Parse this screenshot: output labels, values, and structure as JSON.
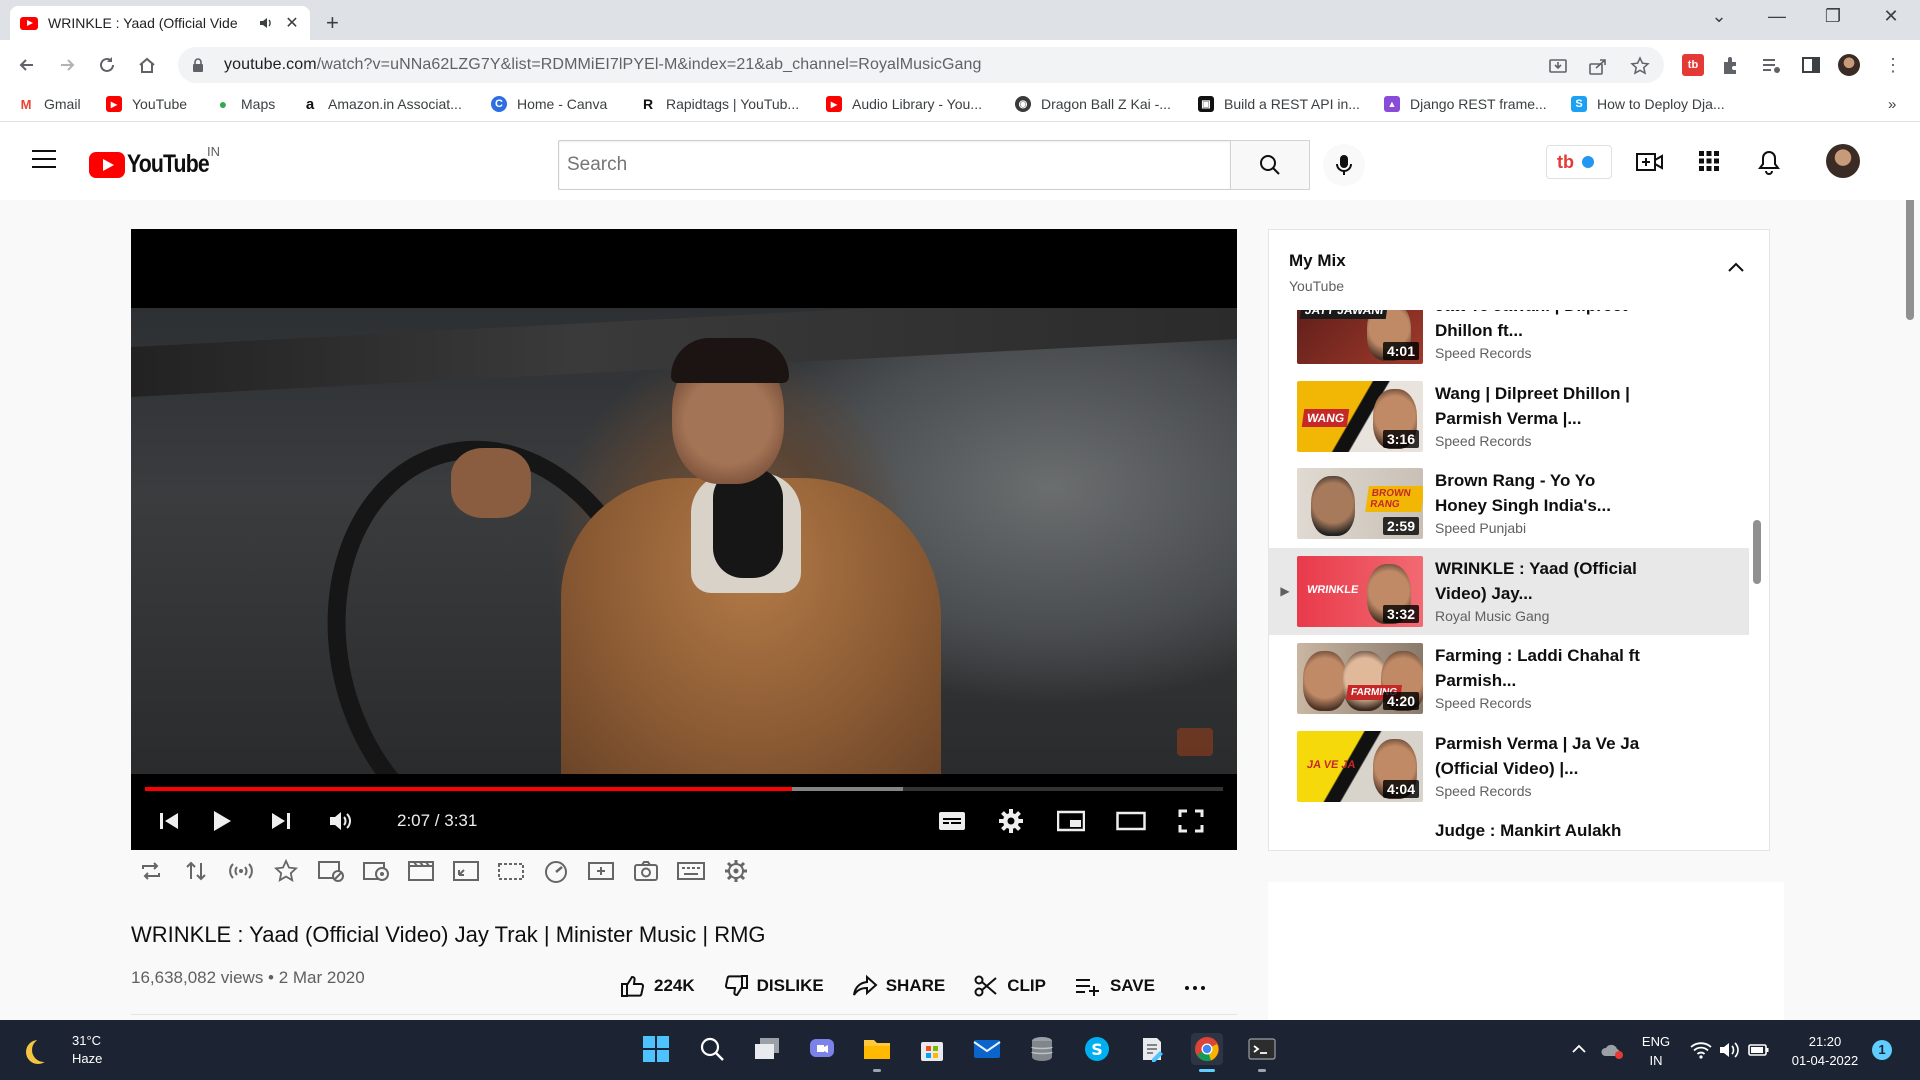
{
  "browser": {
    "tab_title": "WRINKLE : Yaad (Official Vide",
    "address": {
      "host": "youtube.com",
      "path": "/watch?v=uNNa62LZG7Y&list=RDMMiEI7lPYEl-M&index=21&ab_channel=RoyalMusicGang"
    },
    "bookmarks": [
      {
        "label": "Gmail",
        "icon": "gmail-icon",
        "color": "#ea4335",
        "glyph": "M"
      },
      {
        "label": "YouTube",
        "icon": "youtube-icon",
        "color": "#ff0000",
        "glyph": "▶"
      },
      {
        "label": "Maps",
        "icon": "maps-icon",
        "color": "#34a853",
        "glyph": "●"
      },
      {
        "label": "Amazon.in Associat...",
        "icon": "amazon-icon",
        "color": "#ffffff",
        "glyph": "a"
      },
      {
        "label": "Home - Canva",
        "icon": "canva-icon",
        "color": "#2d6ee0",
        "glyph": "C"
      },
      {
        "label": "Rapidtags | YouTub...",
        "icon": "rapidtags-icon",
        "color": "#ffffff",
        "glyph": "R"
      },
      {
        "label": "Audio Library - You...",
        "icon": "youtube-icon",
        "color": "#ff0000",
        "glyph": "▶"
      },
      {
        "label": "Dragon Ball Z Kai -...",
        "icon": "dragonball-icon",
        "color": "#3a3a3a",
        "glyph": "◉"
      },
      {
        "label": "Build a REST API in...",
        "icon": "dev-icon",
        "color": "#111111",
        "glyph": "▣"
      },
      {
        "label": "Django REST frame...",
        "icon": "django-icon",
        "color": "#8a4bd8",
        "glyph": "▲"
      },
      {
        "label": "How to Deploy Dja...",
        "icon": "s-icon",
        "color": "#1ca0f2",
        "glyph": "S"
      }
    ]
  },
  "youtube": {
    "logo_text": "YouTube",
    "country_code": "IN",
    "search_placeholder": "Search",
    "player": {
      "current_time": "2:07",
      "duration": "3:31",
      "time_display": "2:07 / 3:31",
      "progress_fraction": 0.6,
      "buffered_fraction": 0.703
    },
    "video": {
      "title": "WRINKLE : Yaad (Official Video) Jay Trak | Minister Music | RMG",
      "views": "16,638,082 views",
      "date": "2 Mar 2020",
      "view_line": "16,638,082 views • 2 Mar 2020",
      "likes": "224K",
      "dislike_label": "DISLIKE",
      "share_label": "SHARE",
      "clip_label": "CLIP",
      "save_label": "SAVE"
    },
    "playlist": {
      "title": "My Mix",
      "subtitle": "YouTube",
      "items": [
        {
          "title": "Jatt Te Jawani | Dilpreet Dhillon ft...",
          "channel": "Speed Records",
          "duration": "4:01",
          "badge": "JATT JAWANI",
          "color": "#8c2a22",
          "active": false
        },
        {
          "title": "Wang | Dilpreet Dhillon | Parmish Verma |...",
          "channel": "Speed Records",
          "duration": "3:16",
          "badge": "WANG",
          "color": "#f2b705",
          "active": false
        },
        {
          "title": "Brown Rang - Yo Yo Honey Singh India's...",
          "channel": "Speed Punjabi",
          "duration": "2:59",
          "badge": "BROWN RANG",
          "color": "#d6d0c8",
          "active": false
        },
        {
          "title": "WRINKLE : Yaad (Official Video) Jay...",
          "channel": "Royal Music Gang",
          "duration": "3:32",
          "badge": "WRINKLE",
          "color": "#e83a4a",
          "active": true
        },
        {
          "title": "Farming : Laddi Chahal ft Parmish...",
          "channel": "Speed Records",
          "duration": "4:20",
          "badge": "FARMING",
          "color": "#c9b6a3",
          "active": false
        },
        {
          "title": "Parmish Verma | Ja Ve Ja (Official Video) |...",
          "channel": "Speed Records",
          "duration": "4:04",
          "badge": "JA VE JA",
          "color": "#f5d90a",
          "active": false
        },
        {
          "title": "Judge : Mankirt Aulakh",
          "channel": "",
          "duration": "",
          "badge": "",
          "color": "#ffffff",
          "active": false
        }
      ]
    }
  },
  "taskbar": {
    "temperature": "31°C",
    "condition": "Haze",
    "language": "ENG",
    "region": "IN",
    "time": "21:20",
    "date": "01-04-2022",
    "notifications": "1"
  },
  "colors": {
    "youtube_red": "#ff0000",
    "taskbar_bg": "#1c2433",
    "accent_blue": "#60cdff"
  }
}
